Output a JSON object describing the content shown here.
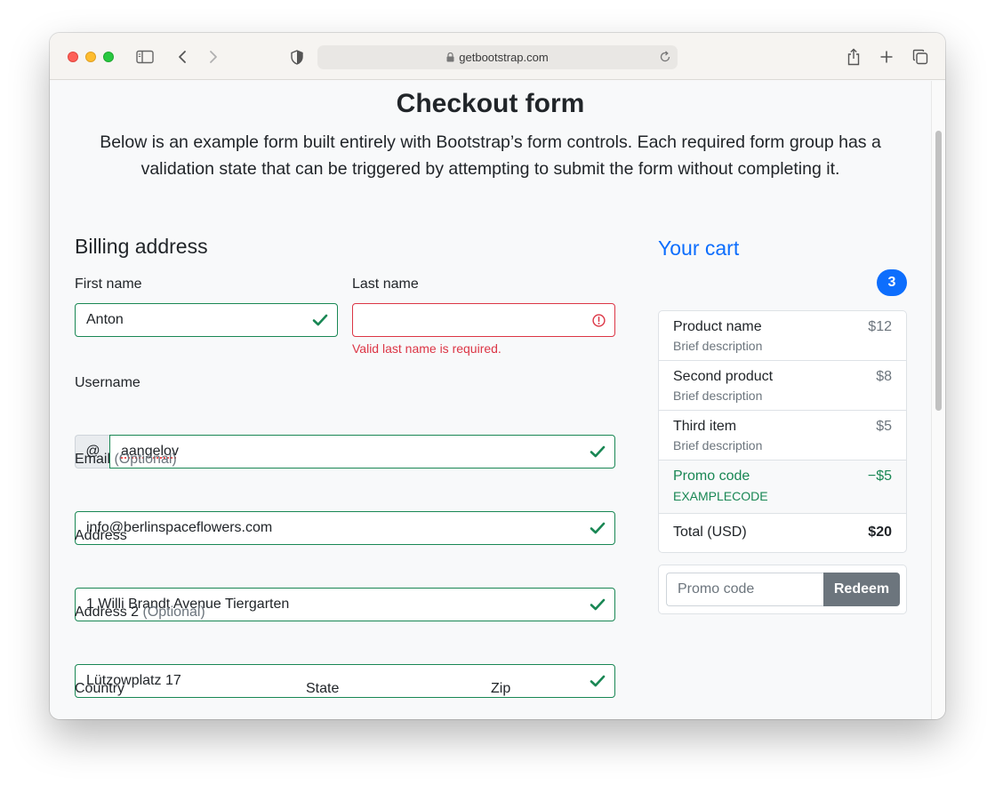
{
  "browser": {
    "url": "getbootstrap.com"
  },
  "page": {
    "title": "Checkout form",
    "lead": "Below is an example form built entirely with Bootstrap’s form controls. Each required form group has a validation state that can be triggered by attempting to submit the form without completing it."
  },
  "billing": {
    "heading": "Billing address",
    "first_name": {
      "label": "First name",
      "value": "Anton",
      "state": "valid"
    },
    "last_name": {
      "label": "Last name",
      "value": "",
      "state": "invalid",
      "feedback": "Valid last name is required."
    },
    "username": {
      "label": "Username",
      "prefix": "@",
      "value": "aangelov",
      "state": "valid"
    },
    "email": {
      "label": "Email",
      "optional": "(Optional)",
      "value": "info@berlinspaceflowers.com",
      "state": "valid"
    },
    "address": {
      "label": "Address",
      "value": "1 Willi Brandt Avenue Tiergarten",
      "state": "valid"
    },
    "address2": {
      "label": "Address 2",
      "optional": "(Optional)",
      "value": "Lützowplatz 17",
      "state": "valid"
    },
    "country": {
      "label": "Country"
    },
    "state": {
      "label": "State"
    },
    "zip": {
      "label": "Zip"
    }
  },
  "cart": {
    "heading": "Your cart",
    "count": "3",
    "items": [
      {
        "name": "Product name",
        "description": "Brief description",
        "price": "$12"
      },
      {
        "name": "Second product",
        "description": "Brief description",
        "price": "$8"
      },
      {
        "name": "Third item",
        "description": "Brief description",
        "price": "$5"
      }
    ],
    "promo": {
      "name": "Promo code",
      "code": "EXAMPLECODE",
      "amount": "−$5"
    },
    "total": {
      "label": "Total (USD)",
      "value": "$20"
    },
    "promo_form": {
      "placeholder": "Promo code",
      "button": "Redeem"
    }
  },
  "colors": {
    "primary": "#0d6efd",
    "valid": "#198754",
    "invalid": "#dc3545",
    "secondary": "#6c757d"
  },
  "icons": {
    "valid": "check-icon",
    "invalid": "exclamation-circle-icon"
  }
}
